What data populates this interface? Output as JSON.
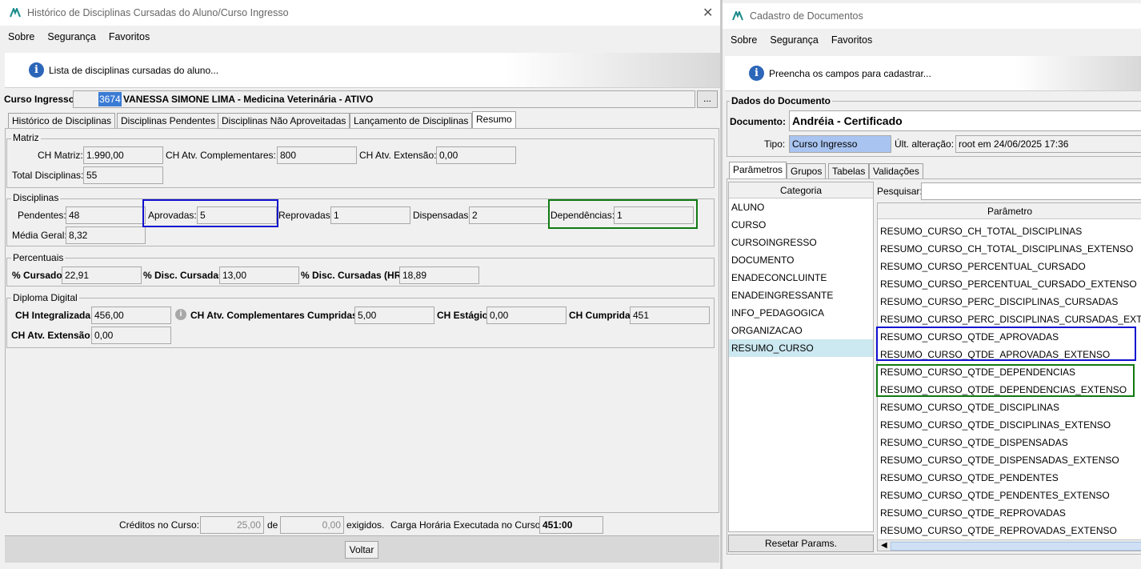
{
  "left_window": {
    "title": "Histórico de Disciplinas Cursadas do Aluno/Curso Ingresso",
    "menu": [
      "Sobre",
      "Segurança",
      "Favoritos"
    ],
    "info_text": "Lista de disciplinas cursadas do aluno...",
    "curso_ingresso_label": "Curso Ingresso:",
    "curso_id": "3674",
    "curso_desc": "VANESSA SIMONE LIMA - Medicina Veterinária - ATIVO",
    "lookup_label": "...",
    "tabs": [
      "Histórico de Disciplinas",
      "Disciplinas Pendentes",
      "Disciplinas Não Aproveitadas",
      "Lançamento de Disciplinas",
      "Resumo"
    ],
    "matriz": {
      "title": "Matriz",
      "ch_matriz_label": "CH Matriz:",
      "ch_matriz": "1.990,00",
      "ch_atv_comp_label": "CH Atv. Complementares:",
      "ch_atv_comp": "800",
      "ch_atv_ext_label": "CH Atv. Extensão:",
      "ch_atv_ext": "0,00",
      "total_disc_label": "Total Disciplinas:",
      "total_disc": "55"
    },
    "disciplinas": {
      "title": "Disciplinas",
      "pendentes_label": "Pendentes:",
      "pendentes": "48",
      "aprovadas_label": "Aprovadas:",
      "aprovadas": "5",
      "reprovadas_label": "Reprovadas:",
      "reprovadas": "1",
      "dispensadas_label": "Dispensadas:",
      "dispensadas": "2",
      "dependencias_label": "Dependências:",
      "dependencias": "1",
      "media_label": "Média Geral:",
      "media": "8,32"
    },
    "percentuais": {
      "title": "Percentuais",
      "cursado_label": "% Cursado:",
      "cursado": "22,91",
      "disc_cursadas_label": "% Disc. Cursadas:",
      "disc_cursadas": "13,00",
      "disc_cursadas_hr_label": "% Disc. Cursadas (HR):",
      "disc_cursadas_hr": "18,89"
    },
    "diploma": {
      "title": "Diploma Digital",
      "ch_integ_label": "CH Integralizada:",
      "ch_integ": "456,00",
      "ch_comp_cumpridas_label": "CH Atv. Complementares Cumpridas:",
      "ch_comp_cumpridas": "5,00",
      "ch_estagio_label": "CH Estágio:",
      "ch_estagio": "0,00",
      "ch_cumprida_label": "CH Cumprida:",
      "ch_cumprida": "451",
      "ch_atv_ext_label": "CH Atv. Extensão:",
      "ch_atv_ext": "0,00"
    },
    "footer": {
      "creditos_label": "Créditos no Curso:",
      "creditos": "25,00",
      "de_label": "de",
      "exigidos": "0,00",
      "exigidos_label": "exigidos.",
      "carga_label": "Carga Horária Executada no Curso:",
      "carga": "451:00"
    },
    "voltar_label": "Voltar"
  },
  "right_window": {
    "title": "Cadastro de Documentos",
    "menu": [
      "Sobre",
      "Segurança",
      "Favoritos"
    ],
    "info_text": "Preencha os campos para cadastrar...",
    "group_title": "Dados do Documento",
    "documento_label": "Documento:",
    "documento": "Andréia - Certificado",
    "tipo_label": "Tipo:",
    "tipo": "Curso Ingresso",
    "ult_alt_label": "Últ. alteração:",
    "ult_alt": "root em 24/06/2025 17:36",
    "tabs": [
      "Parâmetros",
      "Grupos",
      "Tabelas",
      "Validações"
    ],
    "categoria_header": "Categoria",
    "categorias": [
      "ALUNO",
      "CURSO",
      "CURSOINGRESSO",
      "DOCUMENTO",
      "ENADECONCLUINTE",
      "ENADEINGRESSANTE",
      "INFO_PEDAGOGICA",
      "ORGANIZACAO",
      "RESUMO_CURSO"
    ],
    "pesquisar_label": "Pesquisar:",
    "parametro_header": "Parâmetro",
    "parametros": [
      "RESUMO_CURSO_CH_TOTAL_DISCIPLINAS",
      "RESUMO_CURSO_CH_TOTAL_DISCIPLINAS_EXTENSO",
      "RESUMO_CURSO_PERCENTUAL_CURSADO",
      "RESUMO_CURSO_PERCENTUAL_CURSADO_EXTENSO",
      "RESUMO_CURSO_PERC_DISCIPLINAS_CURSADAS",
      "RESUMO_CURSO_PERC_DISCIPLINAS_CURSADAS_EXTENSO",
      "RESUMO_CURSO_QTDE_APROVADAS",
      "RESUMO_CURSO_QTDE_APROVADAS_EXTENSO",
      "RESUMO_CURSO_QTDE_DEPENDENCIAS",
      "RESUMO_CURSO_QTDE_DEPENDENCIAS_EXTENSO",
      "RESUMO_CURSO_QTDE_DISCIPLINAS",
      "RESUMO_CURSO_QTDE_DISCIPLINAS_EXTENSO",
      "RESUMO_CURSO_QTDE_DISPENSADAS",
      "RESUMO_CURSO_QTDE_DISPENSADAS_EXTENSO",
      "RESUMO_CURSO_QTDE_PENDENTES",
      "RESUMO_CURSO_QTDE_PENDENTES_EXTENSO",
      "RESUMO_CURSO_QTDE_REPROVADAS",
      "RESUMO_CURSO_QTDE_REPROVADAS_EXTENSO"
    ],
    "resetar_label": "Resetar Params."
  },
  "colors": {
    "blue_highlight": "#1010d0",
    "green_highlight": "#0f7a12",
    "selection": "#cce8f0",
    "tipo_bg": "#a9c4f0"
  }
}
